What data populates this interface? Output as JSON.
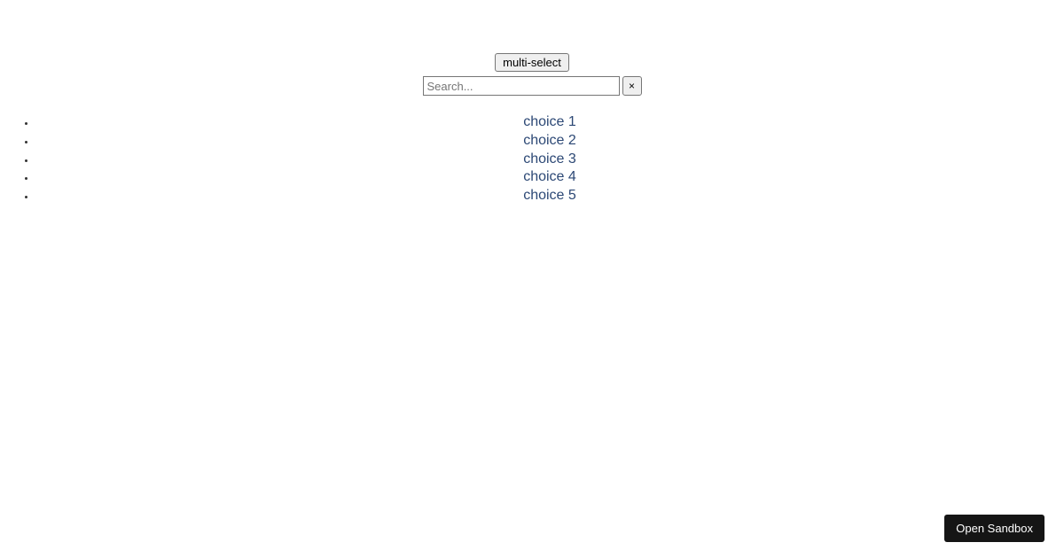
{
  "toolbar": {
    "multi_select_label": "multi-select"
  },
  "search": {
    "placeholder": "Search...",
    "value": "",
    "clear_label": "×"
  },
  "choices": [
    {
      "label": "choice 1"
    },
    {
      "label": "choice 2"
    },
    {
      "label": "choice 3"
    },
    {
      "label": "choice 4"
    },
    {
      "label": "choice 5"
    }
  ],
  "footer": {
    "open_sandbox_label": "Open Sandbox"
  }
}
